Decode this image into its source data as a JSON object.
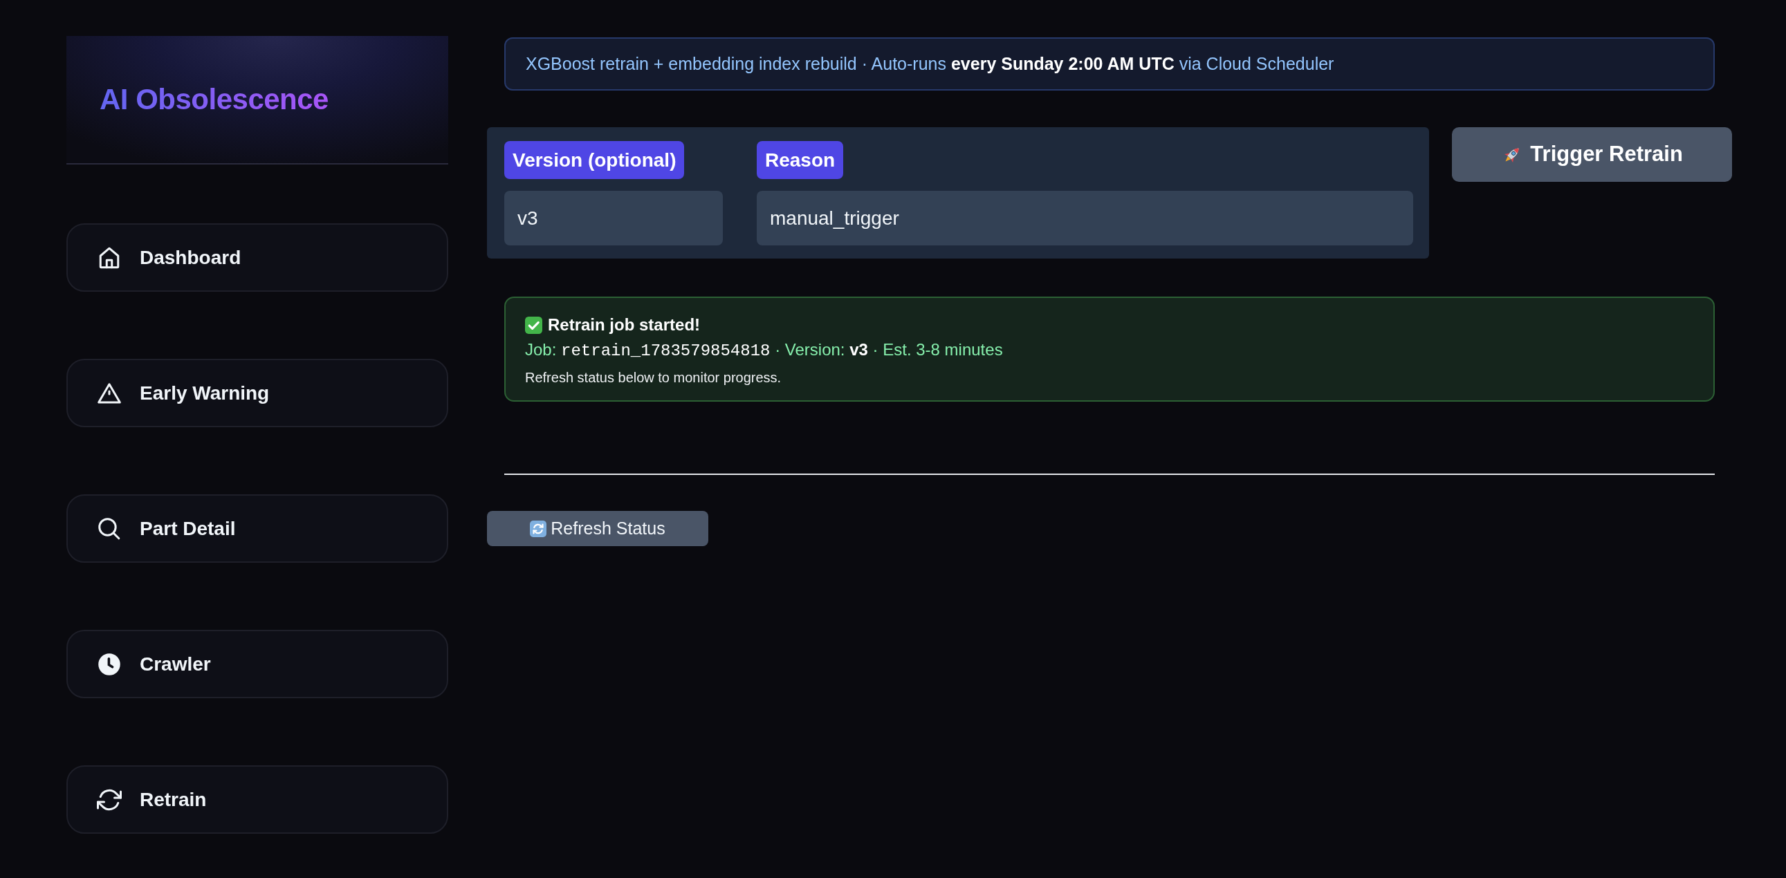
{
  "sidebar": {
    "logo": "AI Obsolescence",
    "items": [
      {
        "label": "Dashboard"
      },
      {
        "label": "Early Warning"
      },
      {
        "label": "Part Detail"
      },
      {
        "label": "Crawler"
      },
      {
        "label": "Retrain"
      }
    ]
  },
  "banner": {
    "text": "XGBoost retrain + embedding index rebuild · Auto-runs **every Sunday 2:00 AM UTC** via Cloud Scheduler"
  },
  "form": {
    "fields": [
      {
        "label": "Version (optional)",
        "value": "v3"
      },
      {
        "label": "Reason",
        "value": "manual_trigger"
      }
    ]
  },
  "trigger_button": {
    "label": "Trigger Retrain"
  },
  "alert": {
    "title": "Retrain job started!",
    "job_label": "Job:",
    "job_id": "retrain_1783579854818",
    "details": "· Version: **v3** · Est. 3-8 minutes",
    "note": "Refresh status below to monitor progress."
  },
  "refresh_button": {
    "label": "Refresh Status"
  }
}
